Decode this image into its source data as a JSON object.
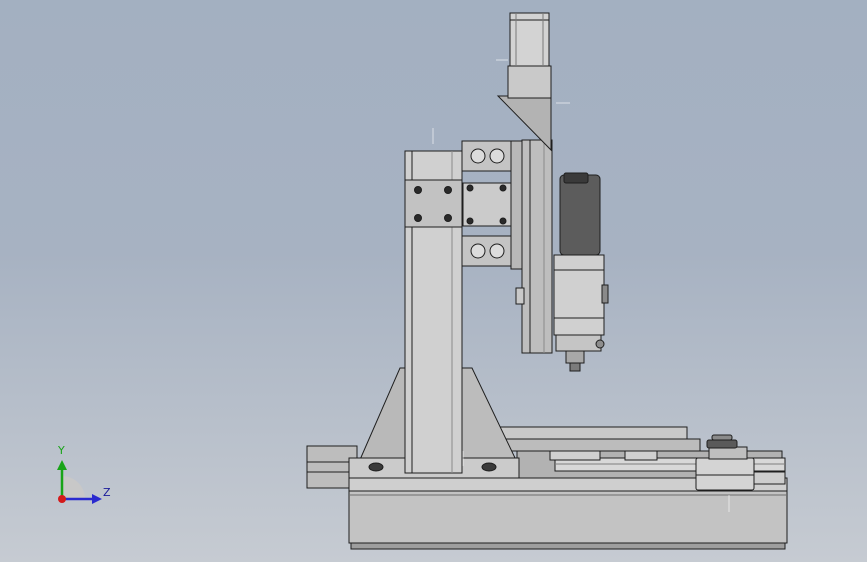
{
  "view": {
    "background_top": "#a3b0c1",
    "background_bottom": "#c6cbd2",
    "part_fill": "#c7c7c7",
    "part_shade": "#9a9a9a",
    "edge_color": "#1e1e1e"
  },
  "triad": {
    "y_label": "Y",
    "z_label": "Z",
    "y_color": "#18a418",
    "z_color": "#2a2acf",
    "x_color": "#d41a1a"
  }
}
